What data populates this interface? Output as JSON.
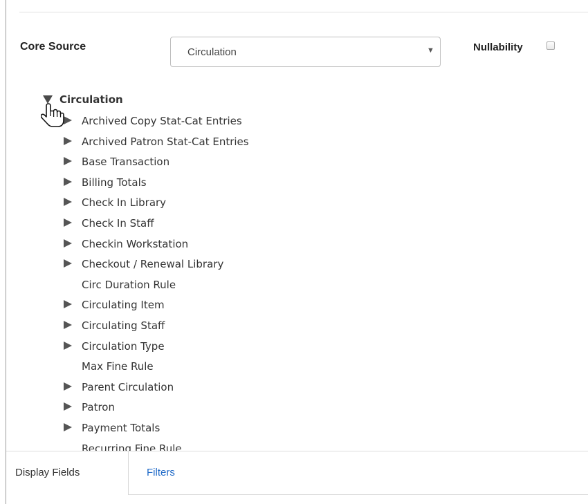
{
  "core_source": {
    "label": "Core Source",
    "selected": "Circulation",
    "dropdown_arrow": "▼"
  },
  "nullability": {
    "label": "Nullability",
    "checked": false
  },
  "tree": {
    "root": {
      "label": "Circulation",
      "expanded": true
    },
    "items": [
      {
        "label": "Archived Copy Stat-Cat Entries",
        "expandable": true
      },
      {
        "label": "Archived Patron Stat-Cat Entries",
        "expandable": true
      },
      {
        "label": "Base Transaction",
        "expandable": true
      },
      {
        "label": "Billing Totals",
        "expandable": true
      },
      {
        "label": "Check In Library",
        "expandable": true
      },
      {
        "label": "Check In Staff",
        "expandable": true
      },
      {
        "label": "Checkin Workstation",
        "expandable": true
      },
      {
        "label": "Checkout / Renewal Library",
        "expandable": true
      },
      {
        "label": "Circ Duration Rule",
        "expandable": false
      },
      {
        "label": "Circulating Item",
        "expandable": true
      },
      {
        "label": "Circulating Staff",
        "expandable": true
      },
      {
        "label": "Circulation Type",
        "expandable": true
      },
      {
        "label": "Max Fine Rule",
        "expandable": false
      },
      {
        "label": "Parent Circulation",
        "expandable": true
      },
      {
        "label": "Patron",
        "expandable": true
      },
      {
        "label": "Payment Totals",
        "expandable": true
      },
      {
        "label": "Recurring Fine Rule",
        "expandable": false
      }
    ]
  },
  "tabs": [
    {
      "label": "Display Fields",
      "active": true
    },
    {
      "label": "Filters",
      "active": false
    }
  ],
  "colors": {
    "link": "#1f6ac8",
    "border": "#d6d6d6",
    "text": "#333333"
  }
}
